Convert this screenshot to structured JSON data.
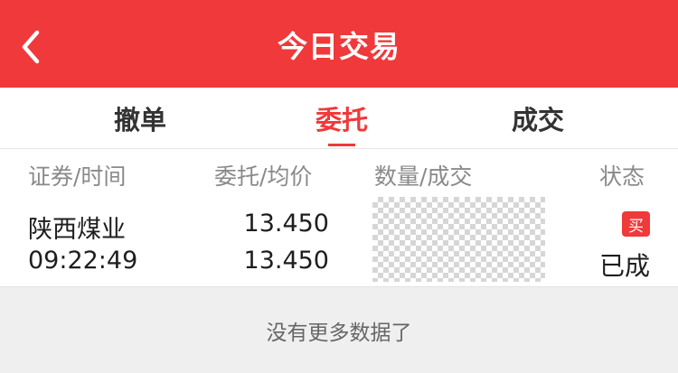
{
  "header": {
    "title": "今日交易",
    "back_icon": "chevron-left-icon",
    "background": "#f0393a"
  },
  "tabs": [
    {
      "label": "撤单",
      "active": false
    },
    {
      "label": "委托",
      "active": true
    },
    {
      "label": "成交",
      "active": false
    }
  ],
  "table": {
    "columns": [
      "证券/时间",
      "委托/均价",
      "数量/成交",
      "状态"
    ],
    "rows": [
      {
        "name": "陕西煤业",
        "time": "09:22:49",
        "order_price": "13.450",
        "avg_price": "13.450",
        "quantity_redacted": true,
        "side_badge": "买",
        "status": "已成"
      }
    ]
  },
  "footer": {
    "text": "没有更多数据了"
  },
  "colors": {
    "accent": "#f0393a",
    "muted_text": "#8a8a8a",
    "footer_bg": "#efefef"
  }
}
